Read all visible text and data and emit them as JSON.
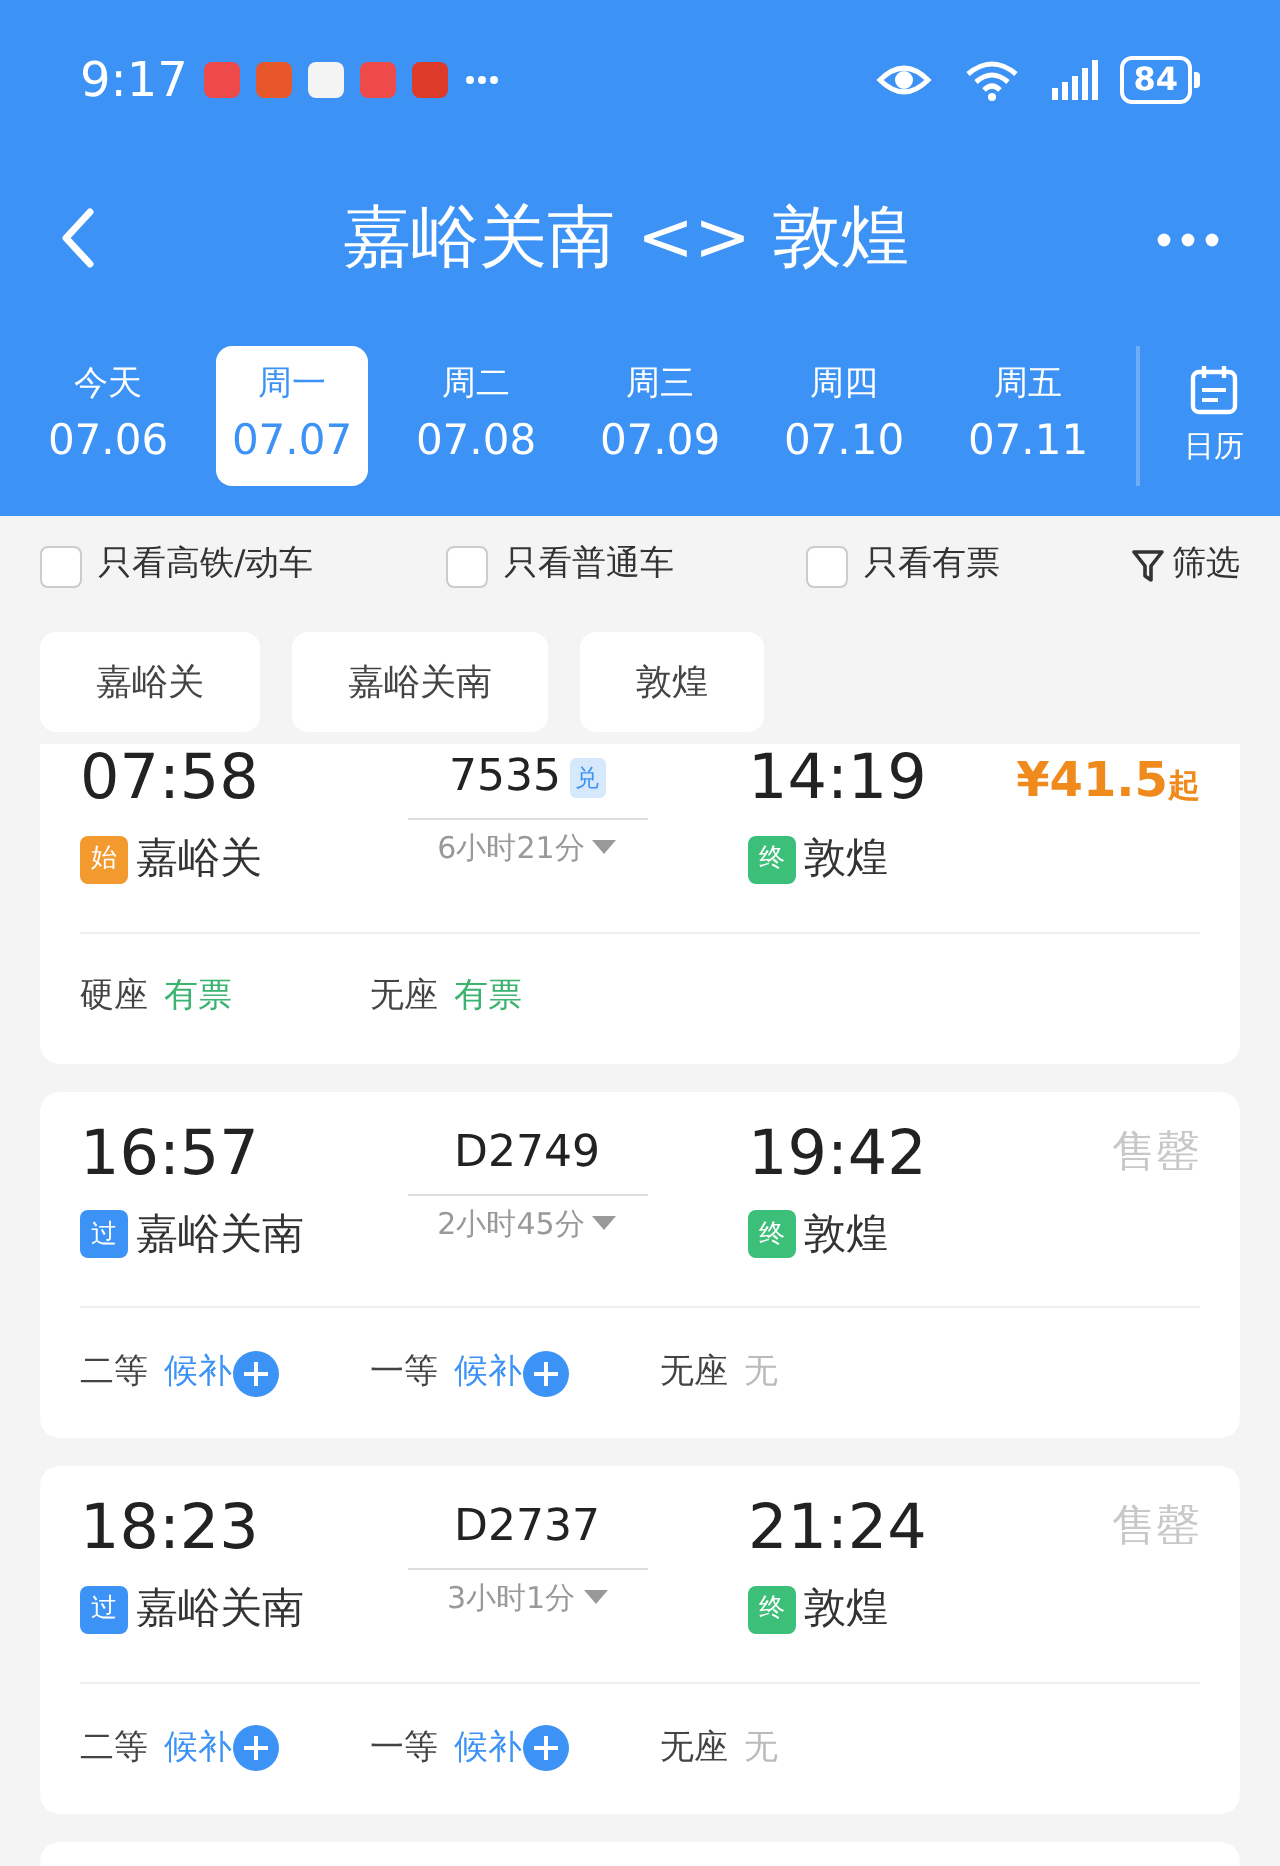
{
  "status_bar": {
    "time": "9:17",
    "battery": "84"
  },
  "header": {
    "title": "嘉峪关南 <> 敦煌"
  },
  "dates": [
    {
      "weekday": "今天",
      "date": "07.06",
      "selected": false
    },
    {
      "weekday": "周一",
      "date": "07.07",
      "selected": true
    },
    {
      "weekday": "周二",
      "date": "07.08",
      "selected": false
    },
    {
      "weekday": "周三",
      "date": "07.09",
      "selected": false
    },
    {
      "weekday": "周四",
      "date": "07.10",
      "selected": false
    },
    {
      "weekday": "周五",
      "date": "07.11",
      "selected": false
    }
  ],
  "calendar_label": "日历",
  "filters": [
    {
      "label": "只看高铁/动车",
      "checked": false
    },
    {
      "label": "只看普通车",
      "checked": false
    },
    {
      "label": "只看有票",
      "checked": false
    }
  ],
  "filter_button": "筛选",
  "stations": [
    {
      "label": "嘉峪关"
    },
    {
      "label": "嘉峪关南"
    },
    {
      "label": "敦煌"
    }
  ],
  "trains": [
    {
      "cut_top": true,
      "depart_time": "07:58",
      "train_no": "7535",
      "tag": "兑",
      "arrive_time": "14:19",
      "price": "¥41.5",
      "price_suffix": "起",
      "from_badge": {
        "label": "始",
        "kind": "start"
      },
      "from_station": "嘉峪关",
      "duration": "6小时21分",
      "to_badge": {
        "label": "终",
        "kind": "end"
      },
      "to_station": "敦煌",
      "seats": [
        {
          "class": "硬座",
          "availability": "有票",
          "kind": "available"
        },
        {
          "class": "无座",
          "availability": "有票",
          "kind": "available"
        }
      ]
    },
    {
      "cut_top": false,
      "depart_time": "16:57",
      "train_no": "D2749",
      "arrive_time": "19:42",
      "status": "售罄",
      "from_badge": {
        "label": "过",
        "kind": "pass"
      },
      "from_station": "嘉峪关南",
      "duration": "2小时45分",
      "to_badge": {
        "label": "终",
        "kind": "end"
      },
      "to_station": "敦煌",
      "seats": [
        {
          "class": "二等",
          "availability": "候补",
          "kind": "waitlist"
        },
        {
          "class": "一等",
          "availability": "候补",
          "kind": "waitlist"
        },
        {
          "class": "无座",
          "availability": "无",
          "kind": "none"
        }
      ]
    },
    {
      "cut_top": false,
      "depart_time": "18:23",
      "train_no": "D2737",
      "arrive_time": "21:24",
      "status": "售罄",
      "from_badge": {
        "label": "过",
        "kind": "pass"
      },
      "from_station": "嘉峪关南",
      "duration": "3小时1分",
      "to_badge": {
        "label": "终",
        "kind": "end"
      },
      "to_station": "敦煌",
      "seats": [
        {
          "class": "二等",
          "availability": "候补",
          "kind": "waitlist"
        },
        {
          "class": "一等",
          "availability": "候补",
          "kind": "waitlist"
        },
        {
          "class": "无座",
          "availability": "无",
          "kind": "none"
        }
      ]
    }
  ]
}
